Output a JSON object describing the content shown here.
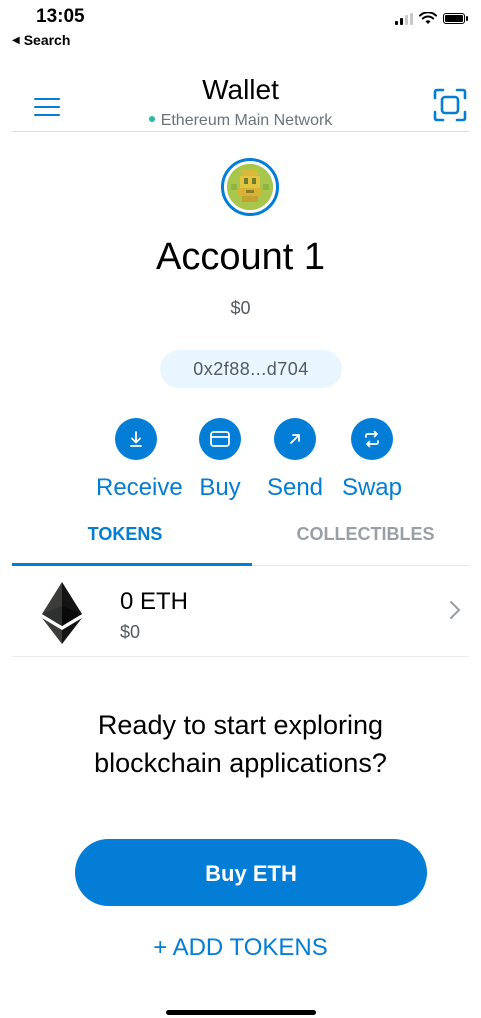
{
  "status_bar": {
    "time": "13:05",
    "back_label": "Search",
    "back_icon": "back-triangle-icon",
    "icons": [
      "signal-icon",
      "wifi-icon",
      "battery-icon"
    ]
  },
  "header": {
    "title": "Wallet",
    "network": "Ethereum Main Network",
    "network_status_color": "#29b6af",
    "menu_icon": "hamburger-menu-icon",
    "scan_icon": "qr-scan-icon"
  },
  "account": {
    "name": "Account 1",
    "balance": "$0",
    "address": "0x2f88...d704",
    "avatar_icon": "identicon-avatar"
  },
  "actions": [
    {
      "label": "Receive",
      "icon": "download-icon"
    },
    {
      "label": "Buy",
      "icon": "card-icon"
    },
    {
      "label": "Send",
      "icon": "arrow-up-right-icon"
    },
    {
      "label": "Swap",
      "icon": "swap-arrows-icon"
    }
  ],
  "tabs": [
    {
      "label": "TOKENS",
      "active": true
    },
    {
      "label": "COLLECTIBLES",
      "active": false
    }
  ],
  "tokens": [
    {
      "amount": "0 ETH",
      "fiat": "$0",
      "icon": "ethereum-logo-icon"
    }
  ],
  "prompt": {
    "text": "Ready to start exploring blockchain applications?",
    "button": "Buy ETH",
    "add_tokens": "+ ADD TOKENS"
  },
  "colors": {
    "accent": "#037dd6",
    "muted_text": "#535a61",
    "tab_inactive": "#9a9fa5"
  }
}
